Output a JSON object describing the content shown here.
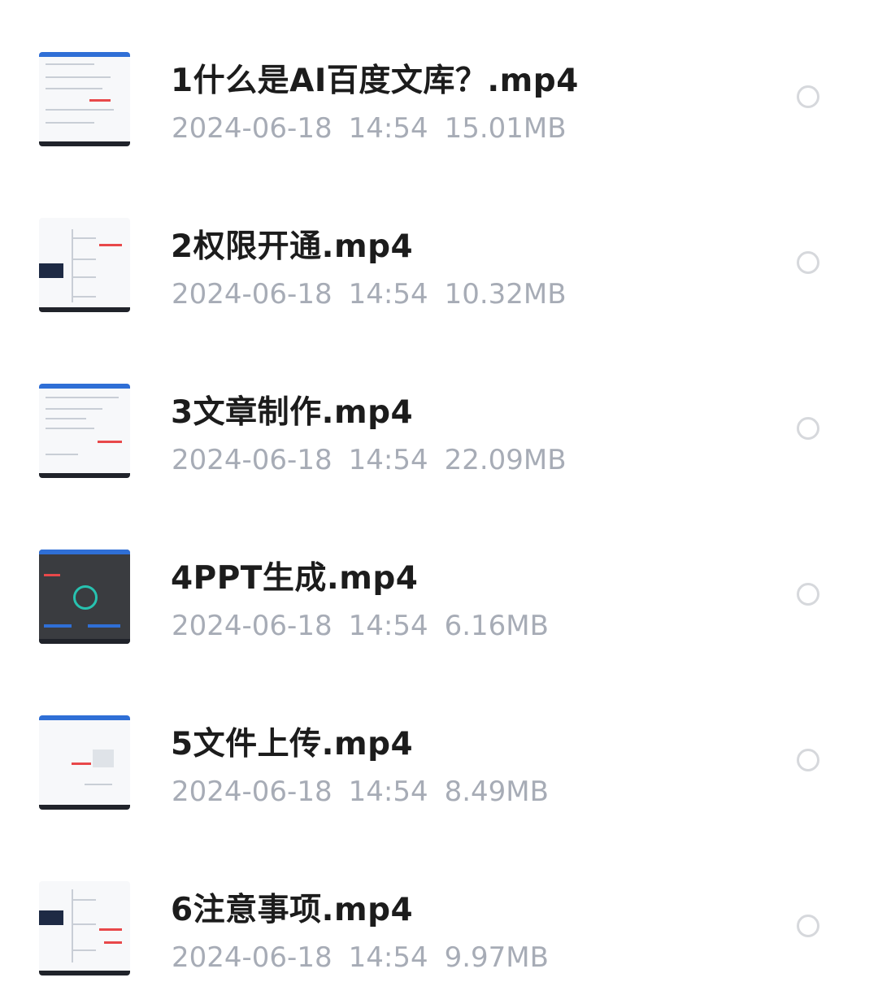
{
  "files": [
    {
      "name": "1什么是AI百度文库？.mp4",
      "date": "2024-06-18",
      "time": "14:54",
      "size": "15.01MB"
    },
    {
      "name": "2权限开通.mp4",
      "date": "2024-06-18",
      "time": "14:54",
      "size": "10.32MB"
    },
    {
      "name": "3文章制作.mp4",
      "date": "2024-06-18",
      "time": "14:54",
      "size": "22.09MB"
    },
    {
      "name": "4PPT生成.mp4",
      "date": "2024-06-18",
      "time": "14:54",
      "size": "6.16MB"
    },
    {
      "name": "5文件上传.mp4",
      "date": "2024-06-18",
      "time": "14:54",
      "size": "8.49MB"
    },
    {
      "name": "6注意事项.mp4",
      "date": "2024-06-18",
      "time": "14:54",
      "size": "9.97MB"
    }
  ]
}
